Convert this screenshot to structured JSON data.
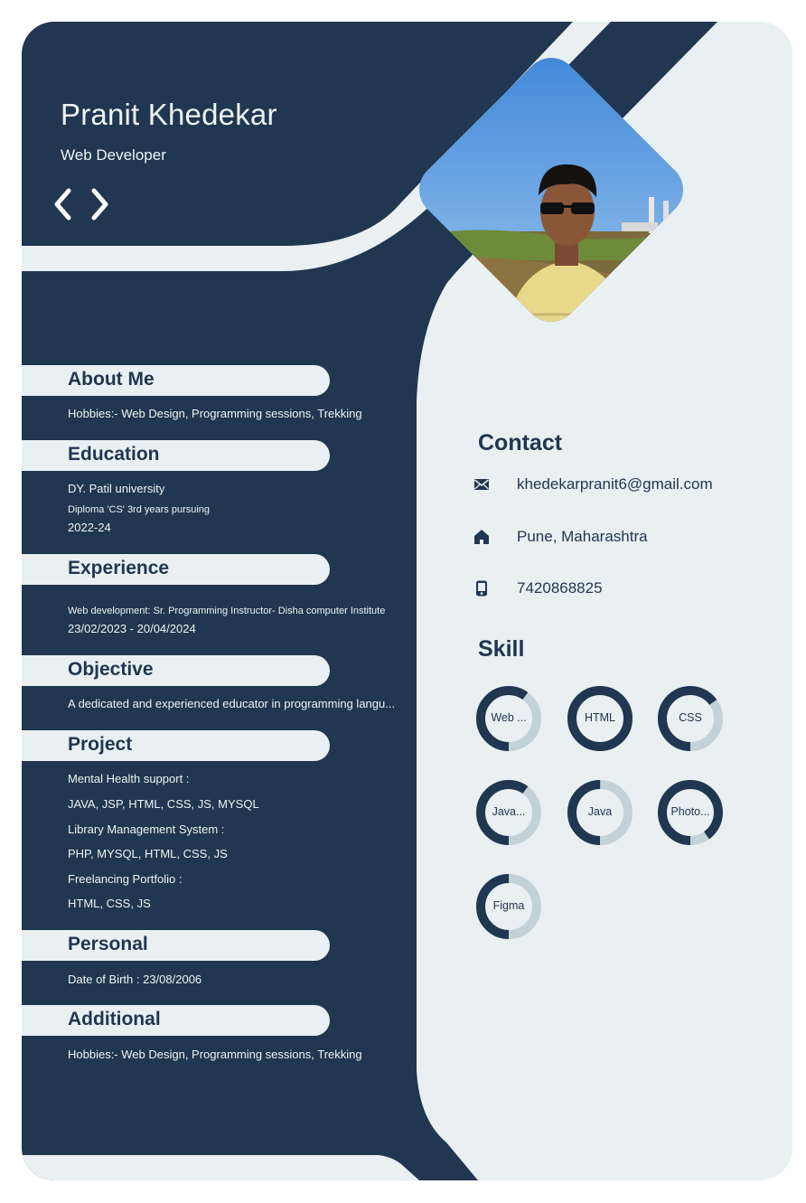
{
  "header": {
    "name": "Pranit Khedekar",
    "title": "Web Developer",
    "icon": "code-icon"
  },
  "sections": [
    {
      "key": "about",
      "heading": "About Me",
      "lines": [
        {
          "text": "Hobbies:- Web Design, Programming sessions, Trekking",
          "small": false
        }
      ]
    },
    {
      "key": "education",
      "heading": "Education",
      "lines": [
        {
          "text": "DY. Patil university",
          "small": false
        },
        {
          "text": "Diploma 'CS' 3rd years pursuing",
          "small": true
        },
        {
          "text": "2022-24",
          "small": false
        }
      ]
    },
    {
      "key": "experience",
      "heading": "Experience",
      "lines": [
        {
          "text": "Web development:  Sr. Programming Instructor- Disha computer Institute",
          "small": true
        },
        {
          "text": "23/02/2023 - 20/04/2024",
          "small": false
        }
      ]
    },
    {
      "key": "objective",
      "heading": "Objective",
      "lines": [
        {
          "text": "A dedicated and experienced educator in programming langu...",
          "small": false
        }
      ]
    },
    {
      "key": "project",
      "heading": "Project",
      "lines": [
        {
          "text": "Mental Health support :",
          "small": false
        },
        {
          "text": "JAVA, JSP, HTML, CSS, JS, MYSQL",
          "small": false
        },
        {
          "text": "Library Management System :",
          "small": false
        },
        {
          "text": "PHP, MYSQL, HTML, CSS, JS",
          "small": false
        },
        {
          "text": "Freelancing Portfolio :",
          "small": false
        },
        {
          "text": "HTML, CSS, JS",
          "small": false
        }
      ]
    },
    {
      "key": "personal",
      "heading": "Personal",
      "lines": [
        {
          "text": "Date of Birth : 23/08/2006",
          "small": false
        }
      ]
    },
    {
      "key": "additional",
      "heading": "Additional",
      "lines": [
        {
          "text": "Hobbies:- Web Design, Programming sessions, Trekking",
          "small": false
        }
      ]
    }
  ],
  "contact": {
    "heading": "Contact",
    "items": [
      {
        "icon": "mail-icon",
        "text": "khedekarpranit6@gmail.com"
      },
      {
        "icon": "home-icon",
        "text": "Pune, Maharashtra"
      },
      {
        "icon": "phone-icon",
        "text": "7420868825"
      }
    ]
  },
  "skills": {
    "heading": "Skill",
    "items": [
      {
        "label": "Web ...",
        "level": 0.6
      },
      {
        "label": "HTML",
        "level": 1.0
      },
      {
        "label": "CSS",
        "level": 0.65
      },
      {
        "label": "Java...",
        "level": 0.6
      },
      {
        "label": "Java",
        "level": 0.5
      },
      {
        "label": "Photo...",
        "level": 0.9
      },
      {
        "label": "Figma",
        "level": 0.5
      }
    ]
  },
  "colors": {
    "navy": "#213650",
    "light": "#e9f0f2",
    "ring_track": "#c3d2d6"
  }
}
